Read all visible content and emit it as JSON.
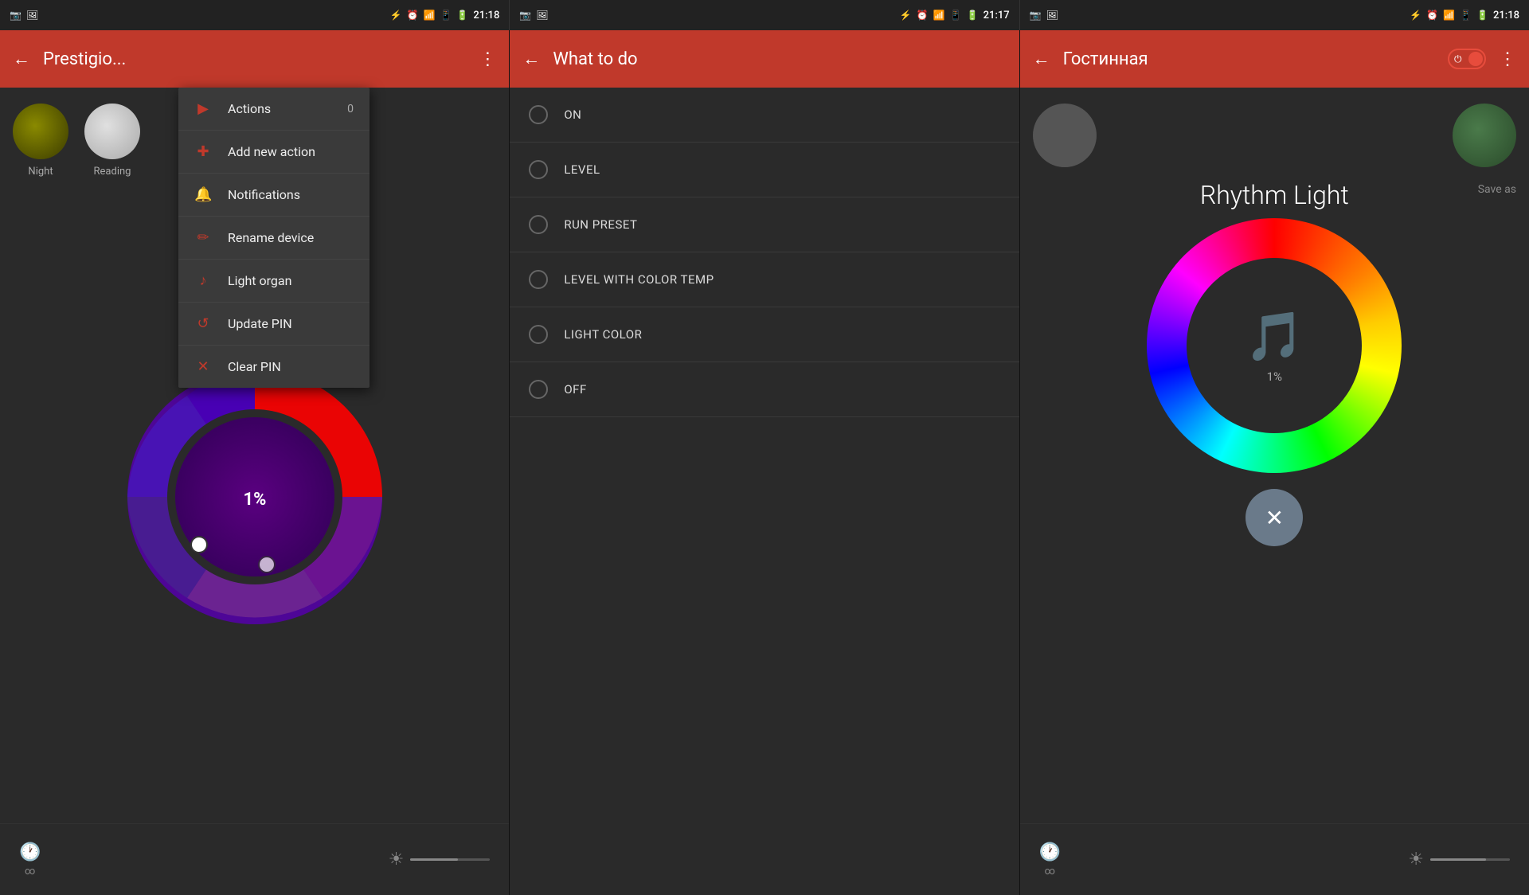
{
  "screens": [
    {
      "id": "screen1",
      "statusBar": {
        "time": "21:18",
        "icons": [
          "bluetooth",
          "alarm",
          "wifi",
          "signal",
          "battery"
        ]
      },
      "appBar": {
        "backLabel": "←",
        "title": "Prestigio...",
        "menuIcon": "⋮"
      },
      "presets": [
        {
          "label": "Night",
          "color": "#6b6b00"
        },
        {
          "label": "Reading",
          "color": "#cccccc"
        }
      ],
      "colorWheel": {
        "percentLabel": "1%"
      },
      "dropdown": {
        "items": [
          {
            "icon": "▶",
            "label": "Actions",
            "badge": "0"
          },
          {
            "icon": "+",
            "label": "Add new action",
            "badge": ""
          },
          {
            "icon": "🔔",
            "label": "Notifications",
            "badge": ""
          },
          {
            "icon": "✏",
            "label": "Rename device",
            "badge": ""
          },
          {
            "icon": "♪",
            "label": "Light organ",
            "badge": ""
          },
          {
            "icon": "↺",
            "label": "Update PIN",
            "badge": ""
          },
          {
            "icon": "✕",
            "label": "Clear PIN",
            "badge": ""
          }
        ]
      },
      "bottomBar": {
        "leftIcon": "🕐",
        "leftText": "∞",
        "rightIcon": "☀",
        "sliderValue": "60"
      }
    },
    {
      "id": "screen2",
      "statusBar": {
        "time": "21:17"
      },
      "appBar": {
        "backLabel": "←",
        "title": "What to do"
      },
      "listItems": [
        {
          "label": "ON"
        },
        {
          "label": "LEVEL"
        },
        {
          "label": "RUN PRESET"
        },
        {
          "label": "LEVEL WITH COLOR TEMP"
        },
        {
          "label": "LIGHT COLOR"
        },
        {
          "label": "OFF"
        }
      ]
    },
    {
      "id": "screen3",
      "statusBar": {
        "time": "21:18"
      },
      "appBar": {
        "backLabel": "←",
        "title": "Гостинная",
        "powerIcon": "⏻",
        "menuIcon": "⋮"
      },
      "rhythmTitle": "Rhythm Light",
      "saveAsLabel": "Save as",
      "percentLabel": "1%",
      "fabClose": "✕",
      "bottomBar": {
        "leftIcon": "🕐",
        "leftText": "∞",
        "rightIcon": "☀"
      }
    }
  ]
}
